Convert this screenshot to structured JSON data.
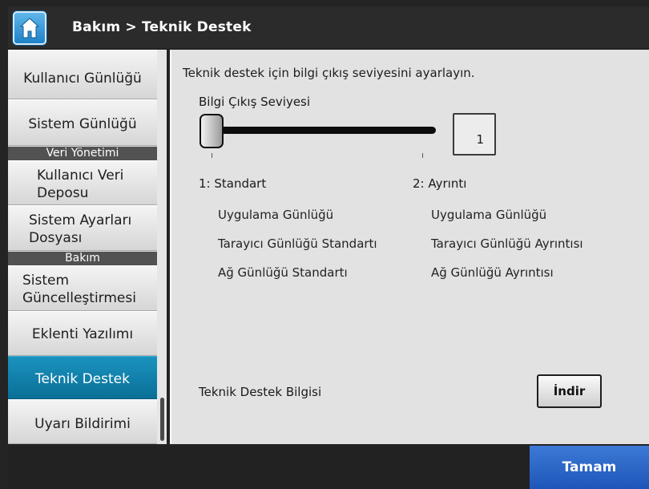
{
  "header": {
    "title": "Bakım > Teknik Destek",
    "home_icon": "home-icon"
  },
  "sidebar": {
    "items": [
      {
        "label": "Kullanıcı Günlüğü"
      },
      {
        "label": "Sistem Günlüğü"
      },
      {
        "section": "Veri Yönetimi"
      },
      {
        "label": "Kullanıcı Veri Deposu"
      },
      {
        "label": "Sistem Ayarları Dosyası"
      },
      {
        "section": "Bakım"
      },
      {
        "label": "Sistem Güncelleştirmesi"
      },
      {
        "label": "Eklenti Yazılımı"
      },
      {
        "label": "Teknik Destek",
        "active": true
      },
      {
        "label": "Uyarı Bildirimi"
      }
    ],
    "labels": {
      "kullanici_gunlugu": "Kullanıcı Günlüğü",
      "sistem_gunlugu": "Sistem Günlüğü",
      "veri_yonetimi": "Veri Yönetimi",
      "kullanici_veri_1": "Kullanıcı Veri",
      "kullanici_veri_2": "Deposu",
      "sistem_ayarlari_1": "Sistem Ayarları",
      "sistem_ayarlari_2": "Dosyası",
      "bakim": "Bakım",
      "sistem_guncelleme_1": "Sistem",
      "sistem_guncelleme_2": "Güncelleştirmesi",
      "eklenti": "Eklenti Yazılımı",
      "teknik_destek": "Teknik Destek",
      "uyari": "Uyarı Bildirimi"
    }
  },
  "main": {
    "description": "Teknik destek için bilgi çıkış seviyesini ayarlayın.",
    "slider": {
      "label": "Bilgi Çıkış Seviyesi",
      "value": "1",
      "min": 1,
      "max": 2
    },
    "levels": [
      {
        "title": "1: Standart",
        "items": [
          "Uygulama Günlüğü",
          "Tarayıcı Günlüğü Standartı",
          "Ağ Günlüğü Standartı"
        ]
      },
      {
        "title": "2: Ayrıntı",
        "items": [
          "Uygulama Günlüğü",
          "Tarayıcı Günlüğü Ayrıntısı",
          "Ağ Günlüğü Ayrıntısı"
        ]
      }
    ],
    "support_info_label": "Teknik Destek Bilgisi",
    "download_label": "İndir"
  },
  "footer": {
    "ok_label": "Tamam"
  },
  "colors": {
    "active_nav": "#0a7ea8",
    "ok_button": "#2a66c8",
    "section_header": "#525252"
  }
}
